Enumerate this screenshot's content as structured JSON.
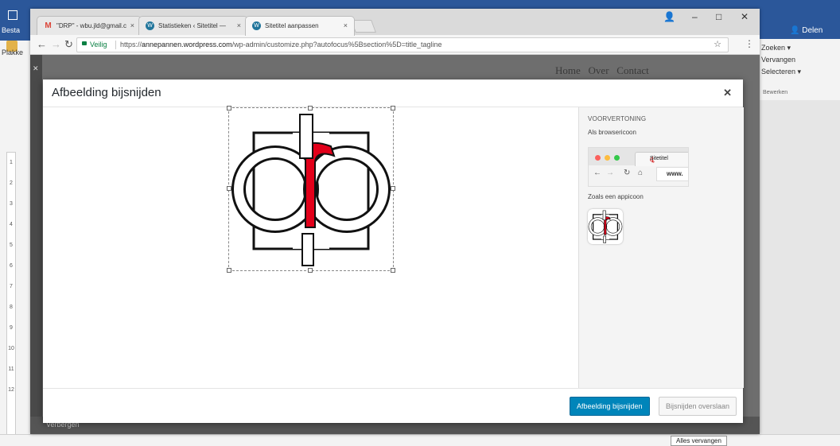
{
  "word": {
    "besta_label": "Besta",
    "plakken_label": "Plakke",
    "share_label": "Delen",
    "editing_menu": [
      "Zoeken",
      "Vervangen",
      "Selecteren"
    ],
    "editing_group": "Bewerken",
    "replace_all_button": "Alles vervangen",
    "ruler_marks": [
      "1",
      "2",
      "3",
      "4",
      "5",
      "6",
      "7",
      "8",
      "9",
      "10",
      "11",
      "12"
    ]
  },
  "browser": {
    "tabs": [
      {
        "title": "\"DRP\" - wbu.jld@gmail.c",
        "favicon": "gmail-icon",
        "color": "#db4437"
      },
      {
        "title": "Statistieken ‹ Sitetitel —",
        "favicon": "wordpress-icon",
        "color": "#21759b"
      },
      {
        "title": "Sitetitel aanpassen",
        "favicon": "wordpress-icon",
        "color": "#21759b"
      }
    ],
    "secure_label": "Veilig",
    "url_prefix": "https://",
    "url_host": "annepannen.wordpress.com",
    "url_path": "/wp-admin/customize.php?autofocus%5Bsection%5D=title_tagline"
  },
  "background_page": {
    "nav_items": [
      "Home",
      "Over",
      "Contact"
    ],
    "bottom_label": "Verbergen"
  },
  "modal": {
    "title": "Afbeelding bijsnijden",
    "preview_heading": "Voorvertoning",
    "browser_icon_label": "Als browsericoon",
    "preview_tab_title": "Sitetitel",
    "preview_url": "www.",
    "app_icon_label": "Zoals een appicoon",
    "crop_button": "Afbeelding bijsnijden",
    "skip_button": "Bijsnijden overslaan"
  },
  "colors": {
    "primary": "#0085ba",
    "logo_red": "#e2001a",
    "word_blue": "#2b579a"
  }
}
